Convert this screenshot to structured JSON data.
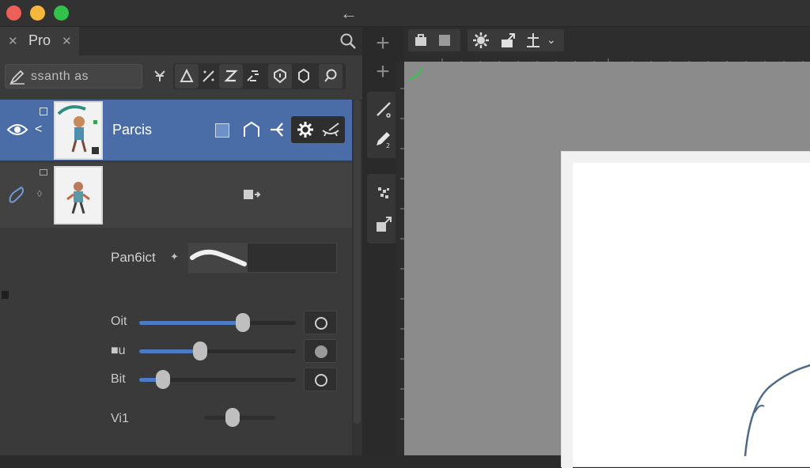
{
  "window": {
    "controls": [
      "close",
      "minimize",
      "zoom"
    ],
    "back_icon": "arrow-left-icon"
  },
  "panel": {
    "tab_label": "Pro",
    "layer_name_value": "ssanth as",
    "layers": [
      {
        "name": "Parcis",
        "selected": true
      },
      {
        "name": "",
        "selected": false
      }
    ]
  },
  "brush": {
    "label": "Pan6ict",
    "sliders": [
      {
        "label": "Oit",
        "value": 0.66
      },
      {
        "label": "■u",
        "value": 0.39
      },
      {
        "label": "Bit",
        "value": 0.15
      },
      {
        "label": "Vi1",
        "value": 0.4
      }
    ]
  },
  "colors": {
    "accent": "#4a6da7",
    "slider_fill": "#4d7ac2",
    "traffic_red": "#ee5f57",
    "traffic_yellow": "#f5b73c",
    "traffic_green": "#32c14a"
  }
}
